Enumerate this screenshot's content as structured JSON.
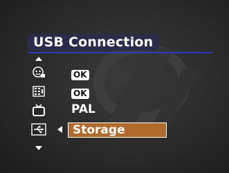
{
  "menu": {
    "title": "USB Connection",
    "items": [
      {
        "icon": "face-detect-icon",
        "value": "OK"
      },
      {
        "icon": "image-settings-icon",
        "value": "OK"
      },
      {
        "icon": "tv-out-icon",
        "value": "PAL"
      },
      {
        "icon": "usb-icon",
        "value": "Storage"
      }
    ],
    "selected_index": 3
  },
  "colors": {
    "title_bg": "#2c2c4a",
    "rule": "#2c3db8",
    "highlight": "#b06a2c"
  }
}
